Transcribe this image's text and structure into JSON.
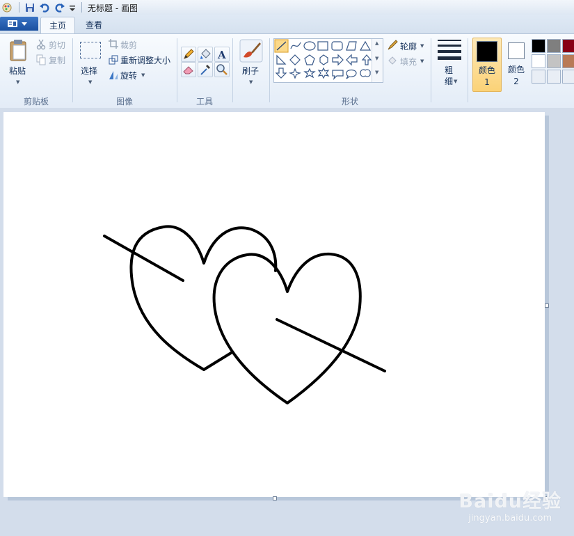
{
  "window": {
    "title": "无标题 - 画图"
  },
  "tabs": {
    "home": "主页",
    "view": "查看"
  },
  "clipboard": {
    "paste": "粘贴",
    "cut": "剪切",
    "copy": "复制",
    "group": "剪贴板"
  },
  "image": {
    "select": "选择",
    "crop": "裁剪",
    "resize": "重新调整大小",
    "rotate": "旋转",
    "group": "图像"
  },
  "tools": {
    "group": "工具",
    "items": [
      "pencil-icon",
      "fill-bucket-icon",
      "text-icon",
      "eraser-icon",
      "color-picker-icon",
      "magnifier-icon"
    ]
  },
  "brushes": {
    "label": "刷子"
  },
  "shapes": {
    "group": "形状",
    "outline": "轮廓",
    "fill": "填充"
  },
  "size": {
    "label": "粗细"
  },
  "colors": {
    "color1_label": "颜色 1",
    "color2_label": "颜色 2",
    "color1": "#000000",
    "color2": "#ffffff",
    "palette": [
      "#000000",
      "#7f7f7f",
      "#880015",
      "#ffffff",
      "#c3c3c3",
      "#b97a57"
    ]
  },
  "watermark": {
    "brand": "Baidu经验",
    "url": "jingyan.baidu.com"
  }
}
